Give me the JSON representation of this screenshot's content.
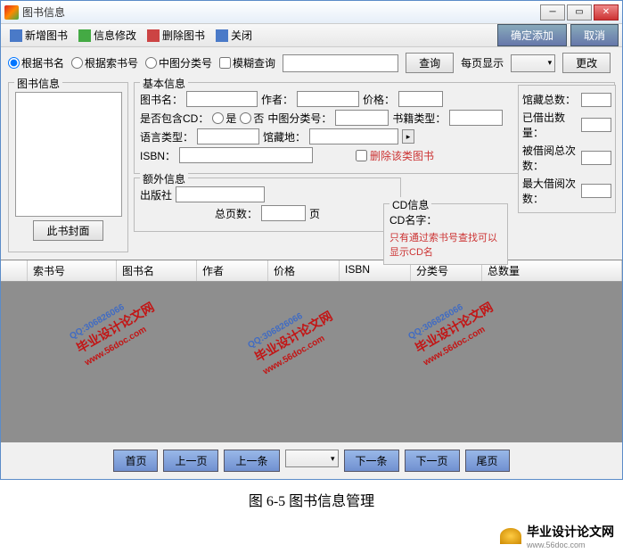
{
  "window": {
    "title": "图书信息"
  },
  "toolbar": {
    "addBook": "新增图书",
    "editInfo": "信息修改",
    "deleteBook": "删除图书",
    "close": "关闭",
    "confirmAdd": "确定添加",
    "cancel": "取消"
  },
  "search": {
    "byBookName": "根据书名",
    "byIndex": "根据索书号",
    "byClass": "中图分类号",
    "fuzzy": "模糊查询",
    "queryBtn": "查询",
    "perPage": "每页显示",
    "changeBtn": "更改"
  },
  "cover": {
    "legend": "图书信息",
    "button": "此书封面"
  },
  "basic": {
    "legend": "基本信息",
    "bookName": "图书名：",
    "author": "作者：",
    "price": "价格：",
    "hasCD": "是否包含CD：",
    "yes": "是",
    "no": "否",
    "class": "中图分类号：",
    "bookType": "书籍类型：",
    "lang": "语言类型：",
    "location": "馆藏地：",
    "isbn": "ISBN：",
    "delThisBook": "删除该类图书"
  },
  "extra": {
    "legend": "额外信息",
    "publisher": "出版社",
    "totalPages": "总页数：",
    "page": "页"
  },
  "cd": {
    "legend": "CD信息",
    "cdName": "CD名字：",
    "hint": "只有通过索书号查找可以显示CD名"
  },
  "stats": {
    "totalCopies": "馆藏总数：",
    "borrowed": "已借出数量：",
    "borrowTotal": "被借阅总次数：",
    "maxBorrow": "最大借阅次数："
  },
  "grid": {
    "cols": [
      "",
      "索书号",
      "图书名",
      "作者",
      "价格",
      "ISBN",
      "分类号",
      "总数量"
    ]
  },
  "pager": {
    "first": "首页",
    "prevPage": "上一页",
    "prevItem": "上一条",
    "nextItem": "下一条",
    "nextPage": "下一页",
    "last": "尾页"
  },
  "caption": "图 6-5 图书信息管理",
  "watermark": {
    "text": "毕业设计论文网",
    "qq": "QQ:306826066",
    "url": "www.56doc.com"
  },
  "footer": {
    "name": "毕业设计论文网",
    "url": "www.56doc.com"
  }
}
